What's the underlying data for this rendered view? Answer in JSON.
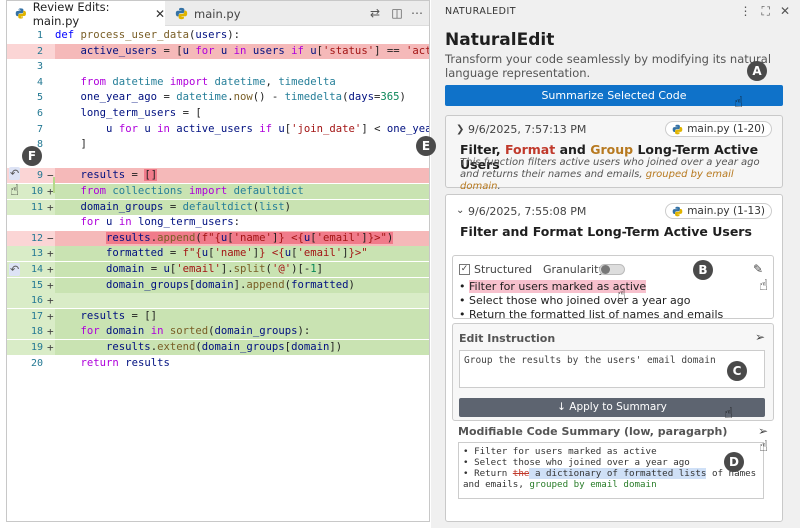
{
  "editor": {
    "tabs": [
      {
        "label": "Review Edits: main.py",
        "close": "✕"
      },
      {
        "label": "main.py"
      }
    ],
    "lines": [
      {
        "num": "1",
        "mark": "",
        "type": "",
        "html": "<span class='kb'>def</span> <span class='f'>process_user_data</span>(<span class='v'>users</span>):"
      },
      {
        "num": "2",
        "mark": "",
        "type": "del",
        "html": "    <span class='v'>active_users</span> = [<span class='v'>u</span> <span class='k'>for</span> <span class='v'>u</span> <span class='k'>in</span> <span class='v'>users</span> <span class='k'>if</span> <span class='v'>u</span>[<span class='s'>'status'</span>] == <span class='s'>'active'</span>]"
      },
      {
        "num": "3",
        "mark": "",
        "type": "",
        "html": ""
      },
      {
        "num": "4",
        "mark": "",
        "type": "",
        "html": "    <span class='k'>from</span> <span class='t'>datetime</span> <span class='k'>import</span> <span class='t'>datetime</span>, <span class='t'>timedelta</span>"
      },
      {
        "num": "5",
        "mark": "",
        "type": "",
        "html": "    <span class='v'>one_year_ago</span> = <span class='t'>datetime</span>.<span class='f'>now</span>() - <span class='t'>timedelta</span>(<span class='v'>days</span>=<span class='n'>365</span>)"
      },
      {
        "num": "6",
        "mark": "",
        "type": "",
        "html": "    <span class='v'>long_term_users</span> = ["
      },
      {
        "num": "7",
        "mark": "",
        "type": "",
        "html": "        <span class='v'>u</span> <span class='k'>for</span> <span class='v'>u</span> <span class='k'>in</span> <span class='v'>active_users</span> <span class='k'>if</span> <span class='v'>u</span>[<span class='s'>'join_date'</span>] &lt; <span class='v'>one_year_ago</span>"
      },
      {
        "num": "8",
        "mark": "",
        "type": "",
        "html": "    ]"
      },
      {
        "num": "",
        "mark": "",
        "type": "",
        "html": ""
      },
      {
        "num": "9",
        "mark": "−",
        "type": "del",
        "html": "    <span class='v'>results</span> = <span class='inl-del'>[]</span>"
      },
      {
        "num": "10",
        "mark": "+",
        "type": "add",
        "html": "    <span class='k'>from</span> <span class='t'>collections</span> <span class='k'>import</span> <span class='t'>defaultdict</span>"
      },
      {
        "num": "11",
        "mark": "+",
        "type": "add",
        "html": "    <span class='v'>domain_groups</span> = <span class='t'>defaultdict</span>(<span class='t'>list</span>)"
      },
      {
        "num": "",
        "mark": "",
        "type": "",
        "html": "    <span class='k'>for</span> <span class='v'>u</span> <span class='k'>in</span> <span class='v'>long_term_users</span>:"
      },
      {
        "num": "12",
        "mark": "−",
        "type": "del",
        "html": "        <span class='inl-del'><span class='v'>results</span>.<span class='f'>append</span>(<span class='s'>f\"{</span><span class='v'>u</span>[<span class='s'>'name'</span>]<span class='s'>} &lt;{</span><span class='v'>u</span>[<span class='s'>'email'</span>]<span class='s'>}&gt;\"</span>)</span>"
      },
      {
        "num": "13",
        "mark": "+",
        "type": "add",
        "html": "        <span class='v'>formatted</span> = <span class='s'>f\"{</span><span class='v'>u</span>[<span class='s'>'name'</span>]<span class='s'>} &lt;{</span><span class='v'>u</span>[<span class='s'>'email'</span>]<span class='s'>}&gt;\"</span>"
      },
      {
        "num": "14",
        "mark": "+",
        "type": "add",
        "html": "        <span class='v'>domain</span> = <span class='v'>u</span>[<span class='s'>'email'</span>].<span class='f'>split</span>(<span class='s'>'@'</span>)[-<span class='n'>1</span>]"
      },
      {
        "num": "15",
        "mark": "+",
        "type": "add",
        "html": "        <span class='v'>domain_groups</span>[<span class='v'>domain</span>].<span class='f'>append</span>(<span class='v'>formatted</span>)"
      },
      {
        "num": "16",
        "mark": "+",
        "type": "add",
        "html": ""
      },
      {
        "num": "17",
        "mark": "+",
        "type": "add",
        "html": "    <span class='v'>results</span> = []"
      },
      {
        "num": "18",
        "mark": "+",
        "type": "add",
        "html": "    <span class='k'>for</span> <span class='v'>domain</span> <span class='k'>in</span> <span class='f'>sorted</span>(<span class='v'>domain_groups</span>):"
      },
      {
        "num": "19",
        "mark": "+",
        "type": "add",
        "html": "        <span class='v'>results</span>.<span class='f'>extend</span>(<span class='v'>domain_groups</span>[<span class='v'>domain</span>])"
      },
      {
        "num": "20",
        "mark": "",
        "type": "",
        "html": "    <span class='k'>return</span> <span class='v'>results</span>"
      }
    ]
  },
  "panel": {
    "header": "NATURALEDIT",
    "title": "NaturalEdit",
    "subtitle": "Transform your code seamlessly by modifying its natural language representation.",
    "summarize_label": "Summarize Selected Code",
    "card1": {
      "date": "9/6/2025, 7:57:13 PM",
      "file": "main.py (1-20)",
      "title_parts": [
        "Filter",
        ", ",
        "Format",
        " and ",
        "Group",
        " Long-Term Active Users"
      ],
      "desc": "This function filters active users who joined over a year ago and returns their names and emails, ",
      "desc_hl": "grouped by email domain",
      "desc_end": "."
    },
    "card2": {
      "date": "9/6/2025, 7:55:08 PM",
      "file": "main.py (1-13)",
      "title": "Filter and Format Long-Term Active Users",
      "structured": "Structured",
      "granularity": "Granularity",
      "bullets": [
        "Filter for users marked as active",
        "Select those who joined over a year ago",
        "Return the formatted list of names and emails"
      ],
      "edit_label": "Edit Instruction",
      "instruction": "Group the results by the users' email domain",
      "apply_label": "↓  Apply to Summary",
      "mod_label": "Modifiable Code Summary (low, paragarph)",
      "mod_lines": [
        "• Filter for users marked as active",
        "• Select those who joined over a year ago"
      ],
      "mod_l3a": "• Return ",
      "mod_strike": "the",
      "mod_blue": " a dictionary of formatted lists",
      "mod_l3b": " of names",
      "mod_l4a": "  and emails, ",
      "mod_green": "grouped by email domain"
    }
  },
  "badges": [
    "A",
    "B",
    "C",
    "D",
    "E",
    "F"
  ],
  "colors": {
    "accent": "#0f72c9",
    "added": "#d9ecc7",
    "removed": "#fbd5d5",
    "badge": "#4a4a4a"
  }
}
